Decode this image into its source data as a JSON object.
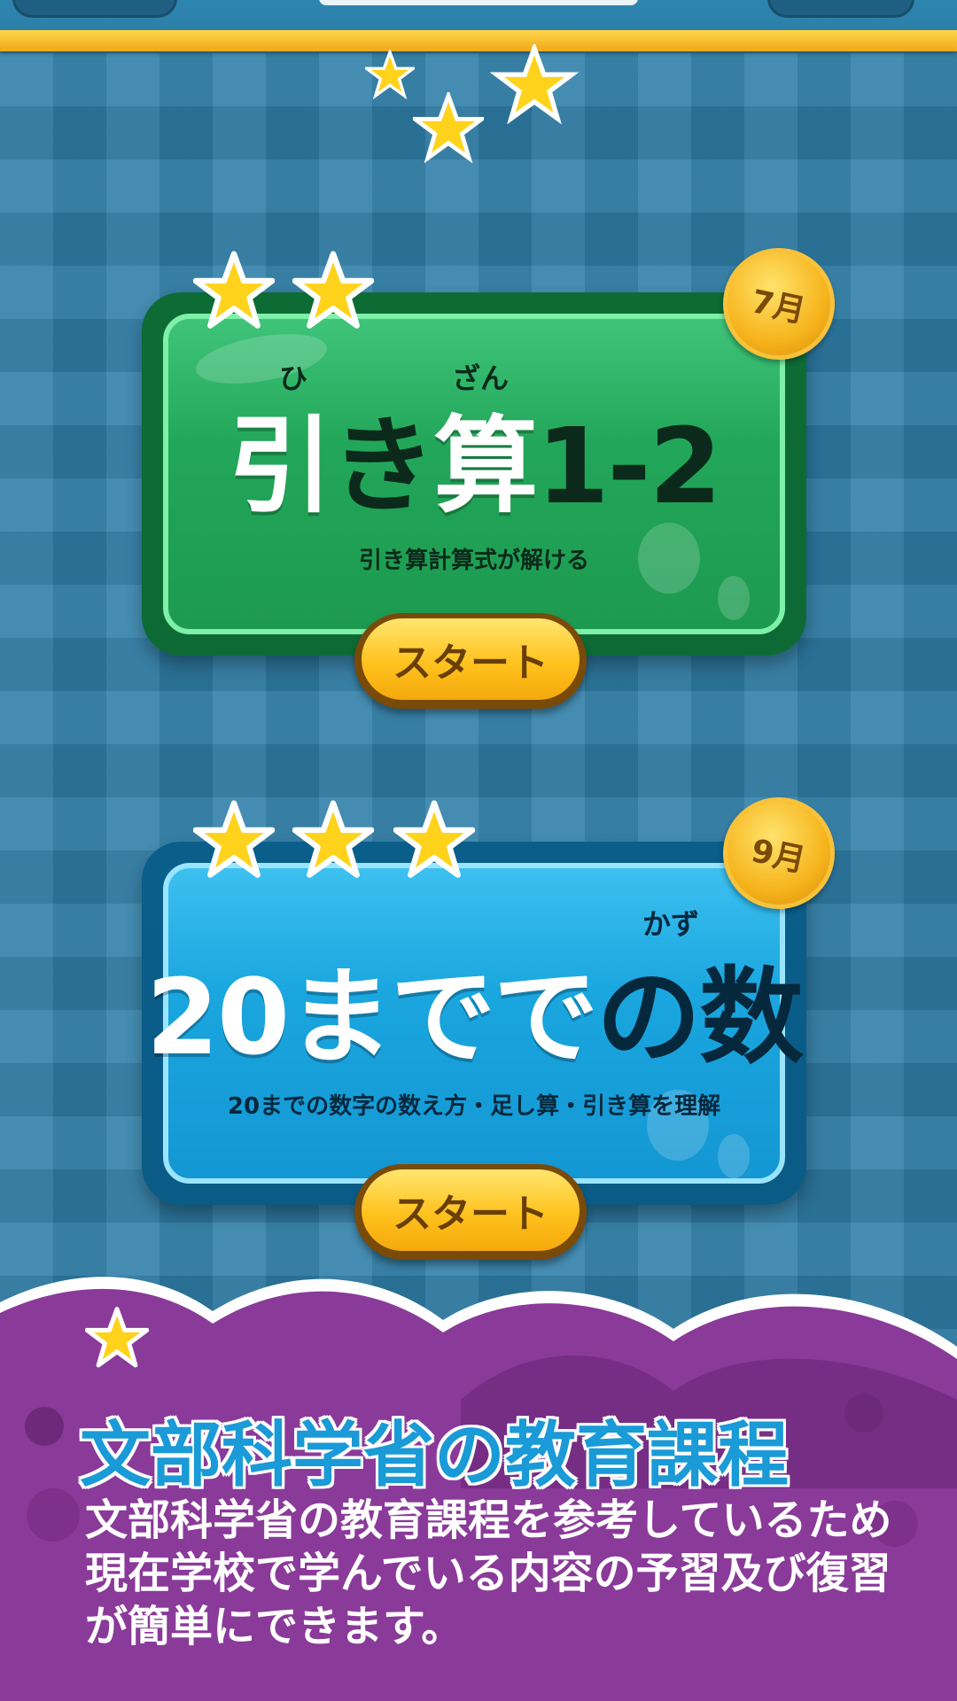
{
  "cards": [
    {
      "ruby_1": "ひ",
      "ruby_2": "ざん",
      "title_white": "引",
      "title_dark": "き",
      "title_white_2": "算",
      "title_dark_2": "1-2",
      "description": "引き算計算式が解ける",
      "month": "7月",
      "stars": 2,
      "start_label": "スタート"
    },
    {
      "ruby_1": "かず",
      "title_white": "20までで",
      "title_dark": "の数",
      "description": "20までの数字の数え方・足し算・引き算を理解",
      "month": "9月",
      "stars": 3,
      "start_label": "スタート"
    }
  ],
  "footer": {
    "title": "文部科学省の教育課程",
    "body_line1": "文部科学省の教育課程を参考しているため",
    "body_line2": "現在学校で学んでいる内容の予習及び復習",
    "body_line3": "が簡単にできます。"
  },
  "colors": {
    "background": "#2f7fa9",
    "green_card": "#22a75a",
    "blue_card": "#1aa6df",
    "purple_footer": "#8a3a99",
    "gold": "#ffc21e"
  }
}
